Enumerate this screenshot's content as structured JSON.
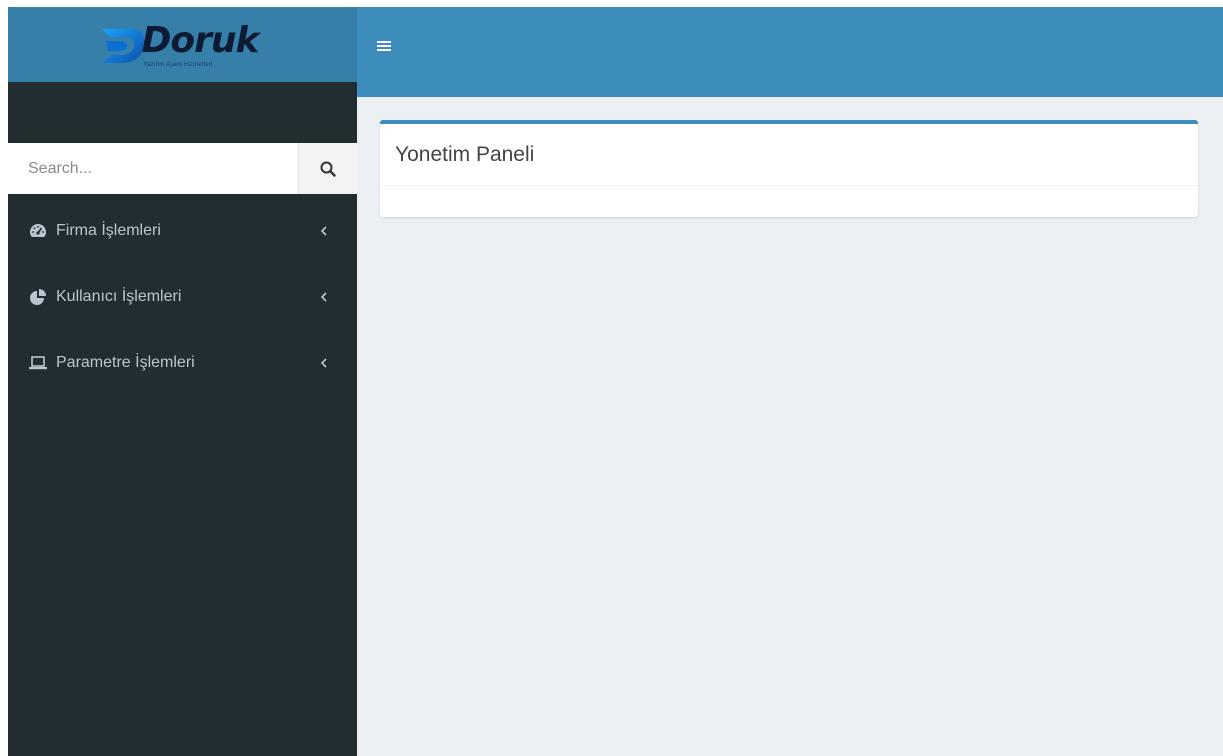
{
  "logo": {
    "name": "Doruk",
    "tagline": "Yazılım Ajans Hizmetleri"
  },
  "search": {
    "placeholder": "Search...",
    "icon": "search-icon"
  },
  "header": {
    "toggle_icon": "hamburger-icon"
  },
  "sidebar": {
    "items": [
      {
        "label": "Firma İşlemleri",
        "icon": "dashboard-icon"
      },
      {
        "label": "Kullanıcı İşlemleri",
        "icon": "pie-chart-icon"
      },
      {
        "label": "Parametre İşlemleri",
        "icon": "laptop-icon"
      }
    ]
  },
  "main": {
    "box_title": "Yonetim Paneli"
  },
  "colors": {
    "header": "#3c8dbc",
    "logo_bg": "#367fa9",
    "sidebar": "#222d32",
    "sidebar_text": "#b8c7ce",
    "content_bg": "#ecf0f5",
    "box_border": "#3c8dbc"
  }
}
